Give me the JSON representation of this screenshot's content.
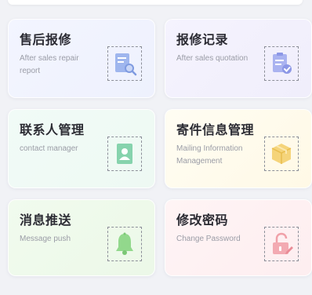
{
  "cards": [
    {
      "title": "售后报修",
      "subtitle": "After sales repair report",
      "icon": "repair-report-icon",
      "color": "#8fa9e6"
    },
    {
      "title": "报修记录",
      "subtitle": "After sales quotation",
      "icon": "quotation-record-icon",
      "color": "#9aa6ec"
    },
    {
      "title": "联系人管理",
      "subtitle": "contact manager",
      "icon": "contact-icon",
      "color": "#7fcfa8"
    },
    {
      "title": "寄件信息管理",
      "subtitle": "Mailing Information Management",
      "icon": "package-icon",
      "color": "#f2cf6e"
    },
    {
      "title": "消息推送",
      "subtitle": "Message push",
      "icon": "bell-icon",
      "color": "#8fd58a"
    },
    {
      "title": "修改密码",
      "subtitle": "Change Password",
      "icon": "lock-icon",
      "color": "#f3a3ab"
    }
  ]
}
